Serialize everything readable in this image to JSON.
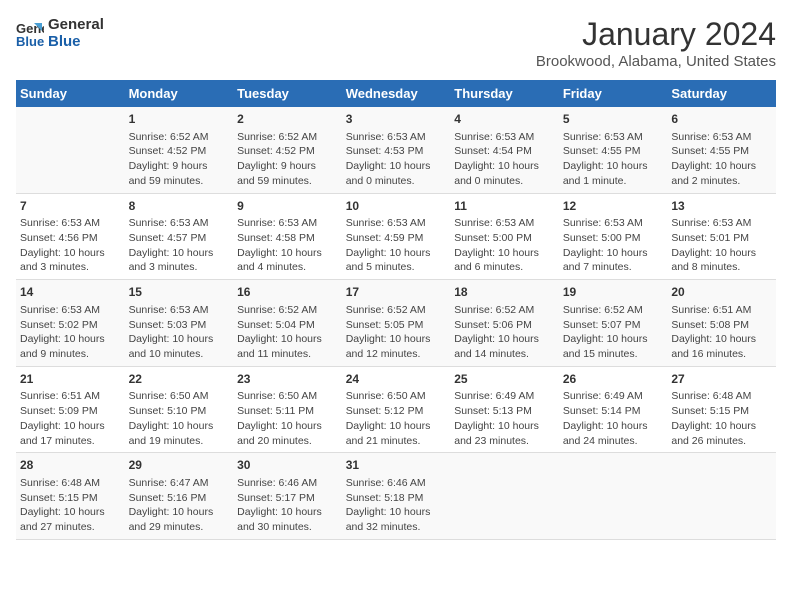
{
  "logo": {
    "line1": "General",
    "line2": "Blue"
  },
  "title": "January 2024",
  "subtitle": "Brookwood, Alabama, United States",
  "days_header": [
    "Sunday",
    "Monday",
    "Tuesday",
    "Wednesday",
    "Thursday",
    "Friday",
    "Saturday"
  ],
  "weeks": [
    [
      {
        "day": "",
        "info": ""
      },
      {
        "day": "1",
        "info": "Sunrise: 6:52 AM\nSunset: 4:52 PM\nDaylight: 9 hours\nand 59 minutes."
      },
      {
        "day": "2",
        "info": "Sunrise: 6:52 AM\nSunset: 4:52 PM\nDaylight: 9 hours\nand 59 minutes."
      },
      {
        "day": "3",
        "info": "Sunrise: 6:53 AM\nSunset: 4:53 PM\nDaylight: 10 hours\nand 0 minutes."
      },
      {
        "day": "4",
        "info": "Sunrise: 6:53 AM\nSunset: 4:54 PM\nDaylight: 10 hours\nand 0 minutes."
      },
      {
        "day": "5",
        "info": "Sunrise: 6:53 AM\nSunset: 4:55 PM\nDaylight: 10 hours\nand 1 minute."
      },
      {
        "day": "6",
        "info": "Sunrise: 6:53 AM\nSunset: 4:55 PM\nDaylight: 10 hours\nand 2 minutes."
      }
    ],
    [
      {
        "day": "7",
        "info": "Sunrise: 6:53 AM\nSunset: 4:56 PM\nDaylight: 10 hours\nand 3 minutes."
      },
      {
        "day": "8",
        "info": "Sunrise: 6:53 AM\nSunset: 4:57 PM\nDaylight: 10 hours\nand 3 minutes."
      },
      {
        "day": "9",
        "info": "Sunrise: 6:53 AM\nSunset: 4:58 PM\nDaylight: 10 hours\nand 4 minutes."
      },
      {
        "day": "10",
        "info": "Sunrise: 6:53 AM\nSunset: 4:59 PM\nDaylight: 10 hours\nand 5 minutes."
      },
      {
        "day": "11",
        "info": "Sunrise: 6:53 AM\nSunset: 5:00 PM\nDaylight: 10 hours\nand 6 minutes."
      },
      {
        "day": "12",
        "info": "Sunrise: 6:53 AM\nSunset: 5:00 PM\nDaylight: 10 hours\nand 7 minutes."
      },
      {
        "day": "13",
        "info": "Sunrise: 6:53 AM\nSunset: 5:01 PM\nDaylight: 10 hours\nand 8 minutes."
      }
    ],
    [
      {
        "day": "14",
        "info": "Sunrise: 6:53 AM\nSunset: 5:02 PM\nDaylight: 10 hours\nand 9 minutes."
      },
      {
        "day": "15",
        "info": "Sunrise: 6:53 AM\nSunset: 5:03 PM\nDaylight: 10 hours\nand 10 minutes."
      },
      {
        "day": "16",
        "info": "Sunrise: 6:52 AM\nSunset: 5:04 PM\nDaylight: 10 hours\nand 11 minutes."
      },
      {
        "day": "17",
        "info": "Sunrise: 6:52 AM\nSunset: 5:05 PM\nDaylight: 10 hours\nand 12 minutes."
      },
      {
        "day": "18",
        "info": "Sunrise: 6:52 AM\nSunset: 5:06 PM\nDaylight: 10 hours\nand 14 minutes."
      },
      {
        "day": "19",
        "info": "Sunrise: 6:52 AM\nSunset: 5:07 PM\nDaylight: 10 hours\nand 15 minutes."
      },
      {
        "day": "20",
        "info": "Sunrise: 6:51 AM\nSunset: 5:08 PM\nDaylight: 10 hours\nand 16 minutes."
      }
    ],
    [
      {
        "day": "21",
        "info": "Sunrise: 6:51 AM\nSunset: 5:09 PM\nDaylight: 10 hours\nand 17 minutes."
      },
      {
        "day": "22",
        "info": "Sunrise: 6:50 AM\nSunset: 5:10 PM\nDaylight: 10 hours\nand 19 minutes."
      },
      {
        "day": "23",
        "info": "Sunrise: 6:50 AM\nSunset: 5:11 PM\nDaylight: 10 hours\nand 20 minutes."
      },
      {
        "day": "24",
        "info": "Sunrise: 6:50 AM\nSunset: 5:12 PM\nDaylight: 10 hours\nand 21 minutes."
      },
      {
        "day": "25",
        "info": "Sunrise: 6:49 AM\nSunset: 5:13 PM\nDaylight: 10 hours\nand 23 minutes."
      },
      {
        "day": "26",
        "info": "Sunrise: 6:49 AM\nSunset: 5:14 PM\nDaylight: 10 hours\nand 24 minutes."
      },
      {
        "day": "27",
        "info": "Sunrise: 6:48 AM\nSunset: 5:15 PM\nDaylight: 10 hours\nand 26 minutes."
      }
    ],
    [
      {
        "day": "28",
        "info": "Sunrise: 6:48 AM\nSunset: 5:15 PM\nDaylight: 10 hours\nand 27 minutes."
      },
      {
        "day": "29",
        "info": "Sunrise: 6:47 AM\nSunset: 5:16 PM\nDaylight: 10 hours\nand 29 minutes."
      },
      {
        "day": "30",
        "info": "Sunrise: 6:46 AM\nSunset: 5:17 PM\nDaylight: 10 hours\nand 30 minutes."
      },
      {
        "day": "31",
        "info": "Sunrise: 6:46 AM\nSunset: 5:18 PM\nDaylight: 10 hours\nand 32 minutes."
      },
      {
        "day": "",
        "info": ""
      },
      {
        "day": "",
        "info": ""
      },
      {
        "day": "",
        "info": ""
      }
    ]
  ]
}
